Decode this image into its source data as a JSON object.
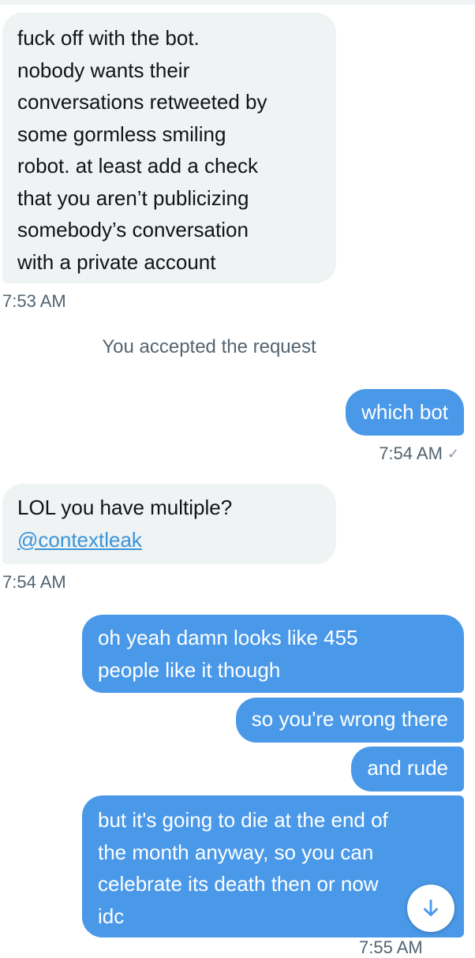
{
  "messages": {
    "m1": {
      "lines": [
        "fuck off with the bot.",
        "nobody wants their",
        "conversations retweeted by",
        "some gormless smiling",
        "robot. at least add a check",
        "that you aren’t publicizing",
        "somebody’s conversation",
        "with a private account"
      ],
      "time": "7:53 AM"
    },
    "system": "You accepted the request",
    "m2": {
      "text": "which bot",
      "time": "7:54 AM"
    },
    "m3": {
      "text": "LOL you have multiple?",
      "mention": "@contextleak",
      "time": "7:54 AM"
    },
    "m4": {
      "lines": [
        "oh yeah damn looks like 455",
        "people like it though"
      ]
    },
    "m5": {
      "text": "so you're wrong there"
    },
    "m6": {
      "text": "and rude"
    },
    "m7": {
      "lines": [
        "but it's going to die at the end of",
        "the month anyway, so you can",
        "celebrate its death then or now",
        "idc"
      ],
      "time_partial": "7:55 AM"
    }
  },
  "colors": {
    "incoming_bubble": "#eff3f4",
    "outgoing_bubble": "#4a99e9",
    "mention": "#3b94d9",
    "timestamp": "#536471"
  },
  "icons": {
    "sent_check": "check-icon",
    "scroll_down": "arrow-down-icon"
  }
}
